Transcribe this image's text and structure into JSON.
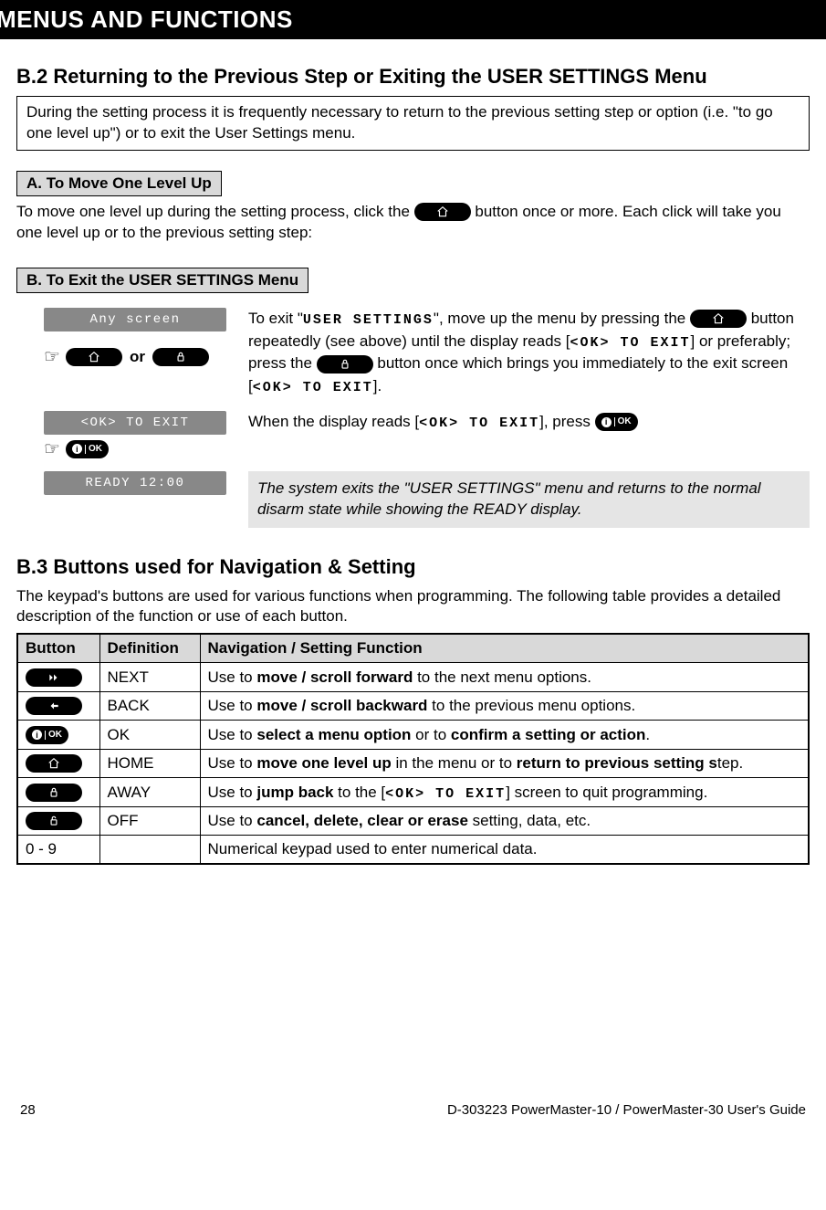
{
  "header": {
    "title": "MENUS AND FUNCTIONS"
  },
  "b2": {
    "heading": "B.2 Returning to the Previous Step or Exiting the USER SETTINGS Menu",
    "intro": "During the setting process it is frequently necessary to return to the previous setting step or option (i.e. \"to go one level up\") or to exit the User Settings menu.",
    "a_head": "A. To Move One Level Up",
    "a_para_pre": "To move one level up during the setting process, click the ",
    "a_para_post": " button once or more. Each click will take you one level up or to the previous setting step:",
    "b_head": "B. To Exit the USER SETTINGS Menu",
    "lcd1": "Any screen",
    "step1_pre": "To exit \"",
    "step1_user_settings": "USER SETTINGS",
    "step1_mid1": "\", move up the menu by pressing the ",
    "step1_mid2": " button repeatedly (see above) until the display reads [",
    "ok_to_exit": "<OK> TO EXIT",
    "step1_mid3": "] or preferably; press the ",
    "step1_mid4": " button once which brings you immediately to the exit screen [",
    "step1_end": "].",
    "or": "or",
    "lcd2": "<OK> TO EXIT",
    "step2_pre": "When the display reads [",
    "step2_mid": "], press ",
    "lcd3": "READY 12:00",
    "note": "The system exits the \"USER SETTINGS\" menu and returns to the normal disarm state while showing the READY display."
  },
  "b3": {
    "heading": "B.3 Buttons used for Navigation & Setting",
    "intro": "The keypad's buttons are used for various functions when programming. The following table provides a detailed description of the function or use of each button.",
    "cols": {
      "button": "Button",
      "definition": "Definition",
      "function": "Navigation / Setting Function"
    },
    "rows": [
      {
        "def": "NEXT",
        "fn_pre": "Use to ",
        "fn_bold": "move / scroll forward",
        "fn_post": " to the next menu options."
      },
      {
        "def": "BACK",
        "fn_pre": "Use to ",
        "fn_bold": "move / scroll backward",
        "fn_post": " to the previous menu options."
      },
      {
        "def": "OK",
        "fn_pre": "Use to ",
        "fn_bold": "select a menu option",
        "fn_mid": " or to ",
        "fn_bold2": "confirm a setting or action",
        "fn_post": "."
      },
      {
        "def": "HOME",
        "fn_pre": "Use to ",
        "fn_bold": "move one level up",
        "fn_mid": " in the menu or to ",
        "fn_bold2": "return to previous setting s",
        "fn_post": "tep."
      },
      {
        "def": "AWAY",
        "fn_pre": "Use to ",
        "fn_bold": "jump back",
        "fn_mid": " to the [",
        "seg": "<OK> TO EXIT",
        "fn_post": "] screen to quit programming."
      },
      {
        "def": "OFF",
        "fn_pre": "Use to ",
        "fn_bold": "cancel, delete, clear or erase",
        "fn_post": " setting, data, etc."
      },
      {
        "def": "",
        "label": "0 - 9",
        "fn_plain": "Numerical keypad used to enter numerical data."
      }
    ]
  },
  "footer": {
    "page": "28",
    "doc": "D-303223 PowerMaster-10 / PowerMaster-30 User's Guide"
  }
}
